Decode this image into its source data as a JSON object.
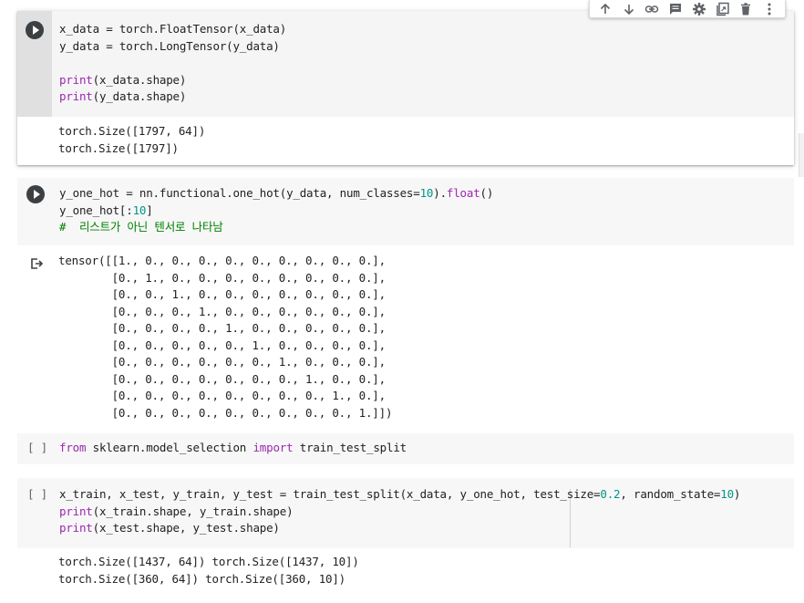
{
  "toolbar": {
    "icons": [
      "arrow-up-icon",
      "arrow-down-icon",
      "link-icon",
      "comment-icon",
      "gear-icon",
      "mirror-cell-icon",
      "trash-icon",
      "more-vert-icon"
    ]
  },
  "cell1": {
    "code": {
      "l1a": "x_data = torch.FloatTensor(x_data)",
      "l2a": "y_data = torch.LongTensor(y_data)",
      "l4fn": "print",
      "l4b": "(x_data.shape)",
      "l5fn": "print",
      "l5b": "(y_data.shape)"
    },
    "output": [
      "torch.Size([1797, 64])",
      "torch.Size([1797])"
    ]
  },
  "cell2": {
    "code": {
      "l1a": "y_one_hot = nn.functional.one_hot(y_data, num_classes=",
      "l1num": "10",
      "l1b": ").",
      "l1fn": "float",
      "l1c": "()",
      "l2a": "y_one_hot[:",
      "l2num": "10",
      "l2b": "]",
      "l3": "#  리스트가 아닌 텐서로 나타남"
    },
    "output": [
      "tensor([[1., 0., 0., 0., 0., 0., 0., 0., 0., 0.],",
      "        [0., 1., 0., 0., 0., 0., 0., 0., 0., 0.],",
      "        [0., 0., 1., 0., 0., 0., 0., 0., 0., 0.],",
      "        [0., 0., 0., 1., 0., 0., 0., 0., 0., 0.],",
      "        [0., 0., 0., 0., 1., 0., 0., 0., 0., 0.],",
      "        [0., 0., 0., 0., 0., 1., 0., 0., 0., 0.],",
      "        [0., 0., 0., 0., 0., 0., 1., 0., 0., 0.],",
      "        [0., 0., 0., 0., 0., 0., 0., 1., 0., 0.],",
      "        [0., 0., 0., 0., 0., 0., 0., 0., 1., 0.],",
      "        [0., 0., 0., 0., 0., 0., 0., 0., 0., 1.]])"
    ]
  },
  "cell3": {
    "prompt": "[ ]",
    "code": {
      "kw1": "from",
      "a": " sklearn.model_selection ",
      "kw2": "import",
      "b": " train_test_split"
    }
  },
  "cell4": {
    "prompt": "[ ]",
    "code": {
      "l1a": "x_train, x_test, y_train, y_test = train_test_split(x_data, y_one_hot, test_size=",
      "l1num1": "0.2",
      "l1b": ", random_state=",
      "l1num2": "10",
      "l1c": ")",
      "l2fn": "print",
      "l2b": "(x_train.shape, y_train.shape)",
      "l3fn": "print",
      "l3b": "(x_test.shape, y_test.shape)"
    },
    "output": [
      "torch.Size([1437, 64]) torch.Size([1437, 10])",
      "torch.Size([360, 64]) torch.Size([360, 10])"
    ]
  }
}
